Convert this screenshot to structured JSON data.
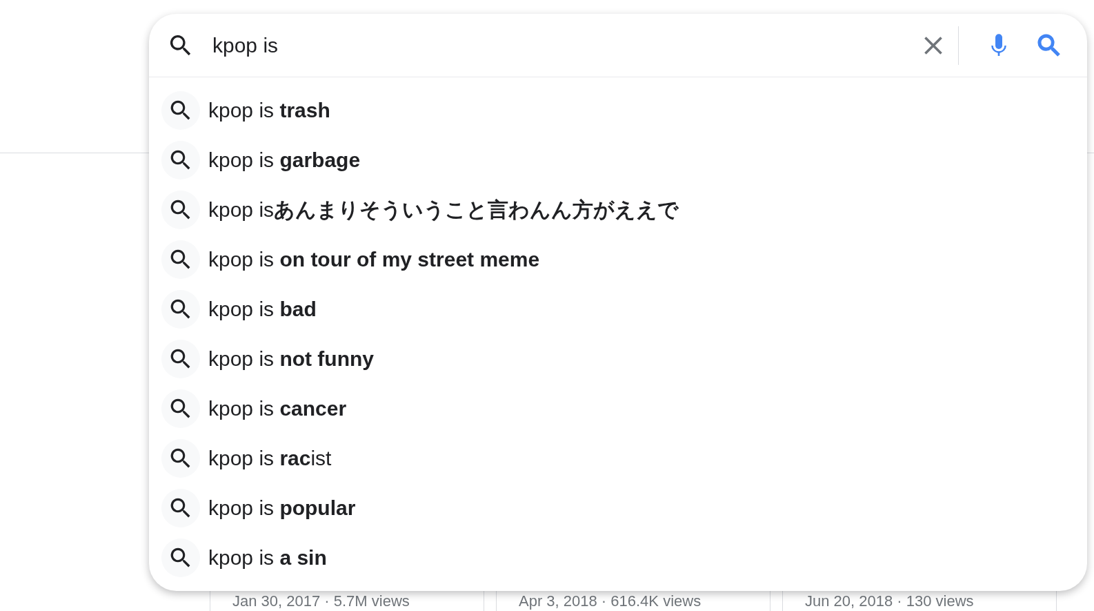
{
  "search": {
    "value": "kpop is"
  },
  "suggestions": [
    "kpop is **trash**",
    "kpop is **garbage**",
    "kpop is**あんまりそういうこと言わんん方がええで**",
    "kpop is **on tour of my street meme**",
    "kpop is **bad**",
    "kpop is **not funny**",
    "kpop is **cancer**",
    "kpop is **rac**ist",
    "kpop is **popular**",
    "kpop is **a sin**"
  ],
  "video_cards": [
    {
      "meta": "Jan 30, 2017 · 5.7M views"
    },
    {
      "meta": "Apr 3, 2018 · 616.4K views"
    },
    {
      "meta": "Jun 20, 2018 · 130 views"
    }
  ]
}
